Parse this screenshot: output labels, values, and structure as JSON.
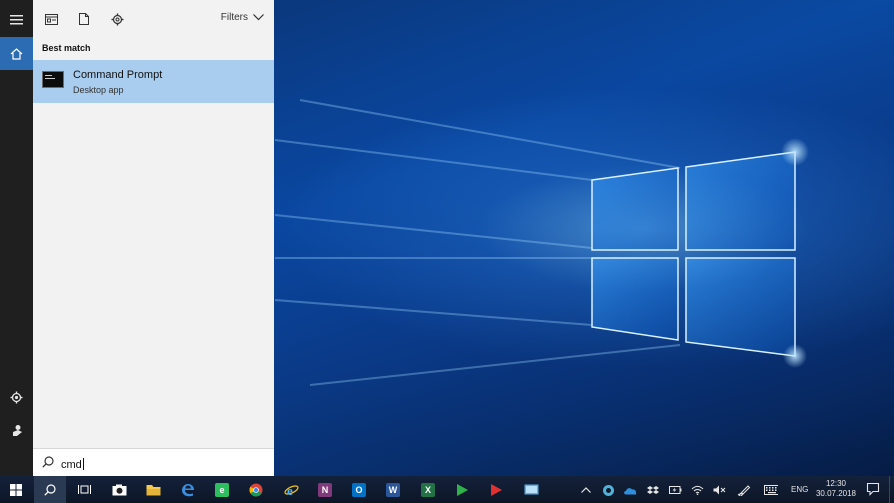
{
  "panel": {
    "filters_label": "Filters",
    "section_heading": "Best match",
    "result": {
      "title": "Command Prompt",
      "subtitle": "Desktop app"
    },
    "search": {
      "value": "cmd"
    }
  },
  "rail": {
    "items": [
      {
        "icon": "hamburger-menu-icon"
      },
      {
        "icon": "home-icon",
        "active": true
      },
      {
        "icon": "settings-icon"
      },
      {
        "icon": "feedback-icon"
      }
    ]
  },
  "taskbar": {
    "apps": [
      {
        "icon": "task-view-icon"
      },
      {
        "icon": "camera-icon"
      },
      {
        "icon": "file-explorer-icon"
      },
      {
        "icon": "edge-icon"
      },
      {
        "icon": "evernote-icon"
      },
      {
        "icon": "chrome-icon"
      },
      {
        "icon": "internet-explorer-icon"
      },
      {
        "icon": "onenote-icon"
      },
      {
        "icon": "outlook-icon"
      },
      {
        "icon": "word-icon"
      },
      {
        "icon": "excel-icon"
      },
      {
        "icon": "green-play-icon"
      },
      {
        "icon": "red-play-icon"
      },
      {
        "icon": "remote-desktop-icon"
      }
    ],
    "language": "ENG",
    "time": "12:30",
    "date": "30.07.2018"
  },
  "colors": {
    "accent": "#2b6cb3",
    "result_highlight": "#a9cdee",
    "rail_bg": "#1f1f1f",
    "panel_bg": "#f2f2f2",
    "taskbar_bg": "#0f1a2b"
  }
}
